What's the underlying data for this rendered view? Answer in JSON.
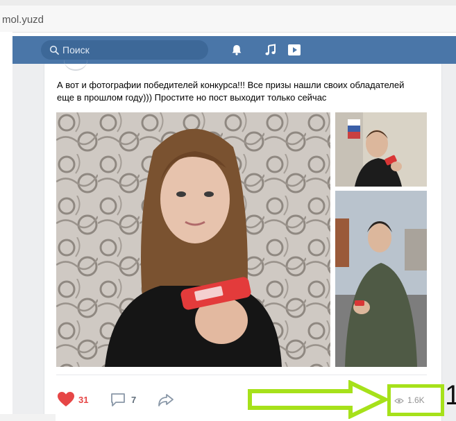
{
  "browser": {
    "url": "mol.yuzd"
  },
  "header": {
    "search_placeholder": "Поиск",
    "brand_color": "#4a76a8",
    "icons": [
      "bell-icon",
      "music-icon",
      "video-icon"
    ]
  },
  "post": {
    "text_line1": "А вот и фотографии победителей конкурса!!! Все призы нашли своих обладателей",
    "text_line2": "еще в прошлом году))) Простите но пост выходит только сейчас",
    "likes": "31",
    "comments": "7",
    "views": "1.6K",
    "like_color": "#e64646"
  },
  "annotation": {
    "number": "1",
    "highlight_color": "#a6e11a"
  }
}
